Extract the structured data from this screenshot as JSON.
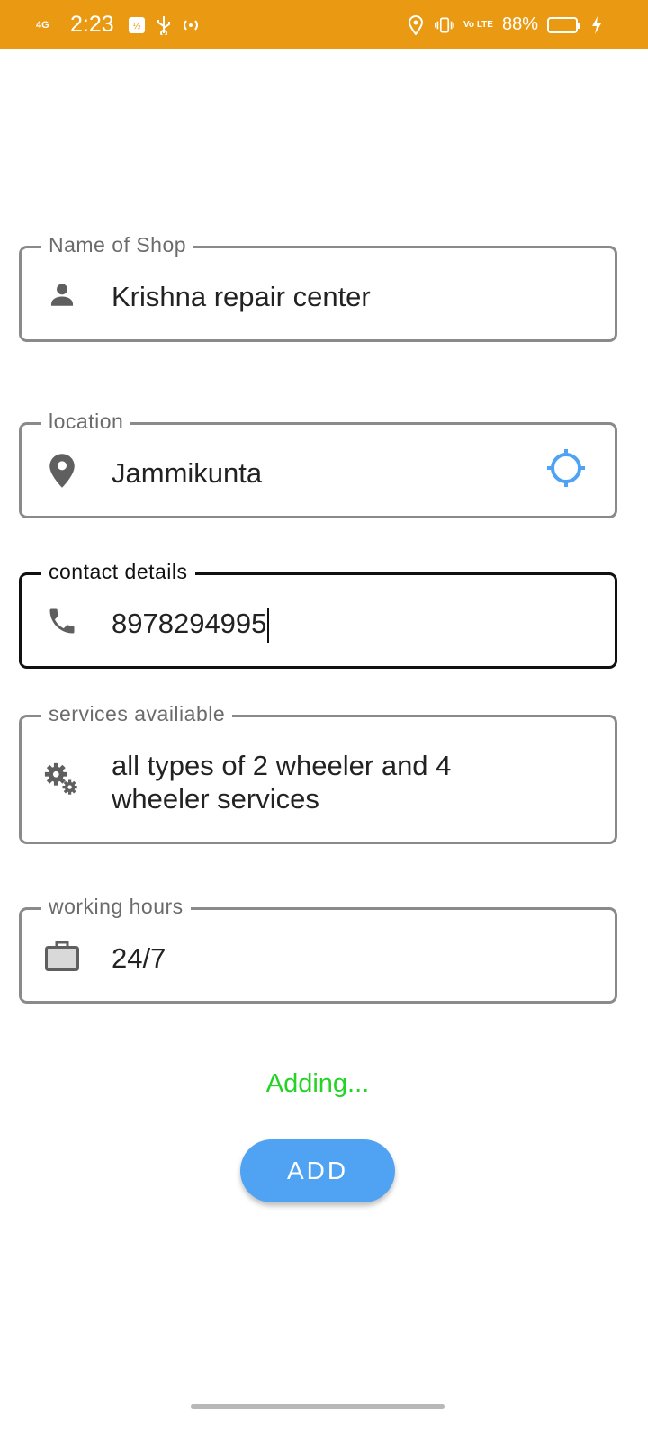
{
  "status_bar": {
    "network": "4G",
    "time": "2:23",
    "lte": "Vo LTE",
    "battery_percent": "88%",
    "battery_level": 0.88
  },
  "form": {
    "shop_name": {
      "label": "Name of Shop",
      "value": "Krishna repair center",
      "icon": "person-icon"
    },
    "location": {
      "label": "location",
      "value": "Jammikunta",
      "icon": "location-pin-icon",
      "action_icon": "gps-locate-icon"
    },
    "contact": {
      "label": "contact details",
      "value": "8978294995",
      "icon": "phone-icon"
    },
    "services": {
      "label": "services availiable",
      "value": "all types of 2 wheeler and 4 wheeler services",
      "icon": "gears-icon"
    },
    "hours": {
      "label": "working hours",
      "value": "24/7",
      "icon": "briefcase-icon"
    }
  },
  "status_message": "Adding...",
  "add_button_label": "ADD",
  "colors": {
    "status_bar": "#E99A12",
    "button": "#4FA3F2",
    "status_message": "#25D326",
    "locate_icon": "#4FA3F2"
  }
}
